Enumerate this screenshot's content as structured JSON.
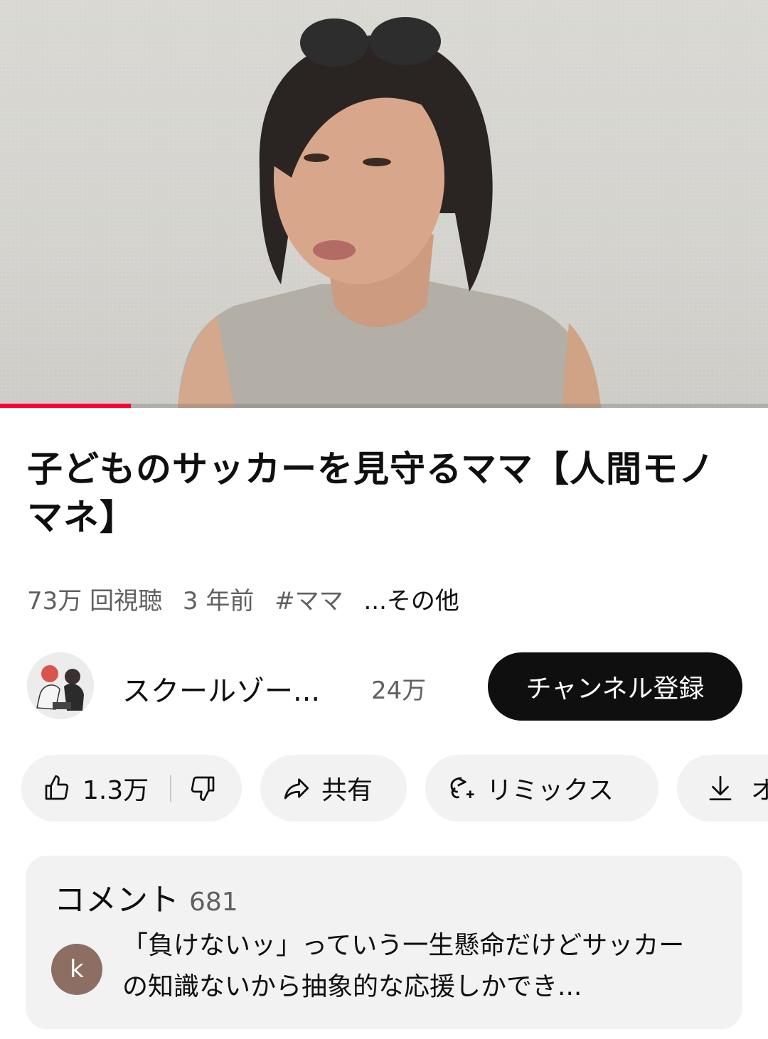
{
  "player": {
    "progress_fraction": 0.17
  },
  "video": {
    "title": "子どものサッカーを見守るママ【人間モノマネ】",
    "views": "73万 回視聴",
    "age": "3 年前",
    "hashtag": "#ママ",
    "more": "...その他"
  },
  "channel": {
    "name": "スクールゾー...",
    "subscribers": "24万",
    "subscribe_label": "チャンネル登録"
  },
  "actions": {
    "like_count": "1.3万",
    "share_label": "共有",
    "remix_label": "リミックス",
    "download_label": "オ"
  },
  "comments": {
    "label": "コメント",
    "count": "681",
    "top_comment_author_initial": "k",
    "top_comment_text": "「負けないッ」っていう一生懸命だけどサッカーの知識ないから抽象的な応援しかでき..."
  },
  "icons": {
    "like": "thumbs-up-icon",
    "dislike": "thumbs-down-icon",
    "share": "share-arrow-icon",
    "remix": "remix-icon",
    "download": "download-icon"
  },
  "colors": {
    "progress": "#ff0033",
    "subscribe_bg": "#0f0f0f",
    "chip_bg": "#f2f2f2",
    "comment_avatar": "#8d6e63"
  }
}
